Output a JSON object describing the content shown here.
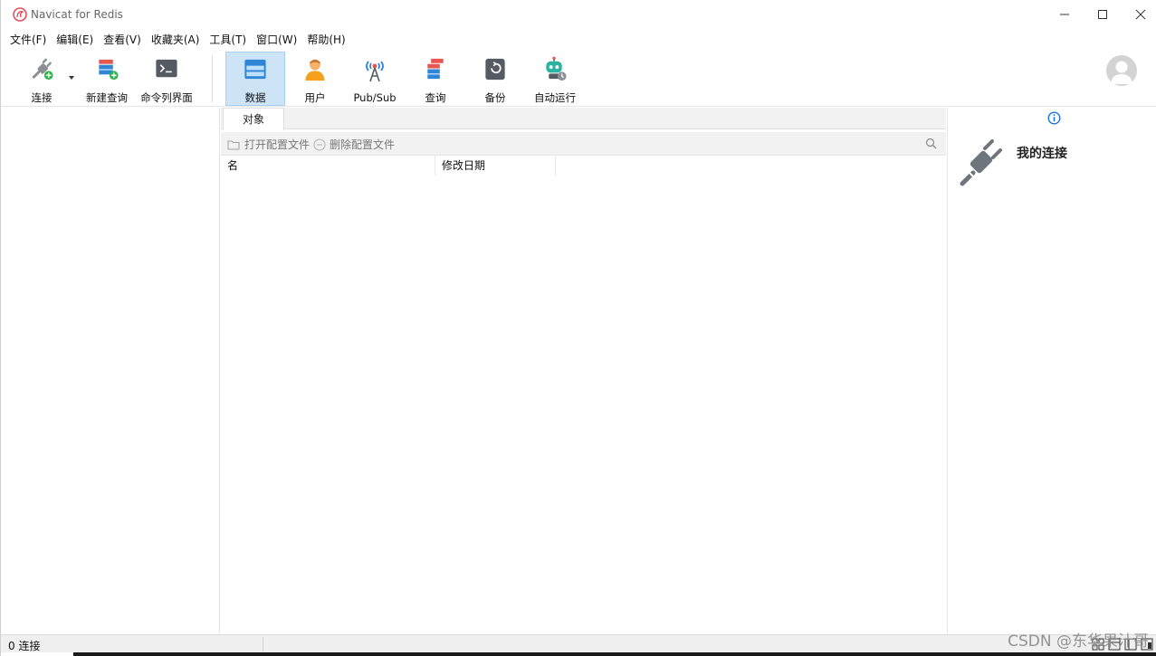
{
  "window": {
    "title": "Navicat for Redis"
  },
  "menu": [
    "文件(F)",
    "编辑(E)",
    "查看(V)",
    "收藏夹(A)",
    "工具(T)",
    "窗口(W)",
    "帮助(H)"
  ],
  "toolbar": {
    "connect": "连接",
    "new_query": "新建查询",
    "console": "命令列界面",
    "data": "数据",
    "user": "用户",
    "pubsub": "Pub/Sub",
    "query": "查询",
    "backup": "备份",
    "automation": "自动运行"
  },
  "objects": {
    "tab": "对象",
    "open_profile": "打开配置文件",
    "delete_profile": "删除配置文件",
    "columns": [
      "名",
      "修改日期"
    ]
  },
  "info_panel": {
    "title": "我的连接"
  },
  "status": {
    "connections": "0 连接"
  },
  "watermark": "CSDN @东华果汁哥"
}
